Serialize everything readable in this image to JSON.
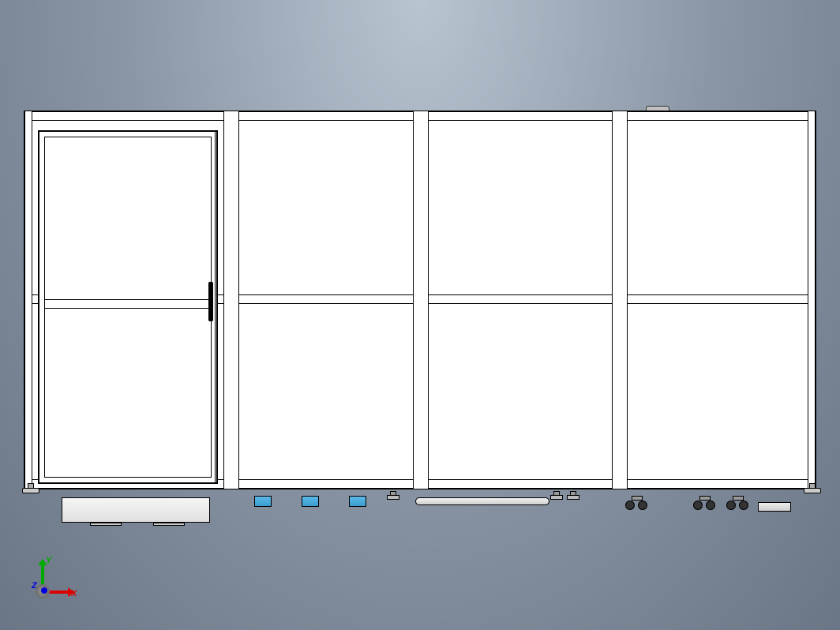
{
  "viewport": {
    "background_gradient_top": "#b8c4d0",
    "background_gradient_bottom": "#6a7685"
  },
  "model": {
    "type": "enclosure-frame",
    "sections": 4,
    "door_section": 1,
    "colors": {
      "frame_fill": "#ffffff",
      "frame_line": "#000000",
      "blue_box": "#3a9dd0",
      "foot": "#cccccc",
      "handle": "#000000"
    }
  },
  "coordinate_triad": {
    "x_label": "X",
    "y_label": "Y",
    "z_label": "Z",
    "x_color": "#dd0000",
    "y_color": "#00aa00",
    "z_color": "#0000dd"
  }
}
